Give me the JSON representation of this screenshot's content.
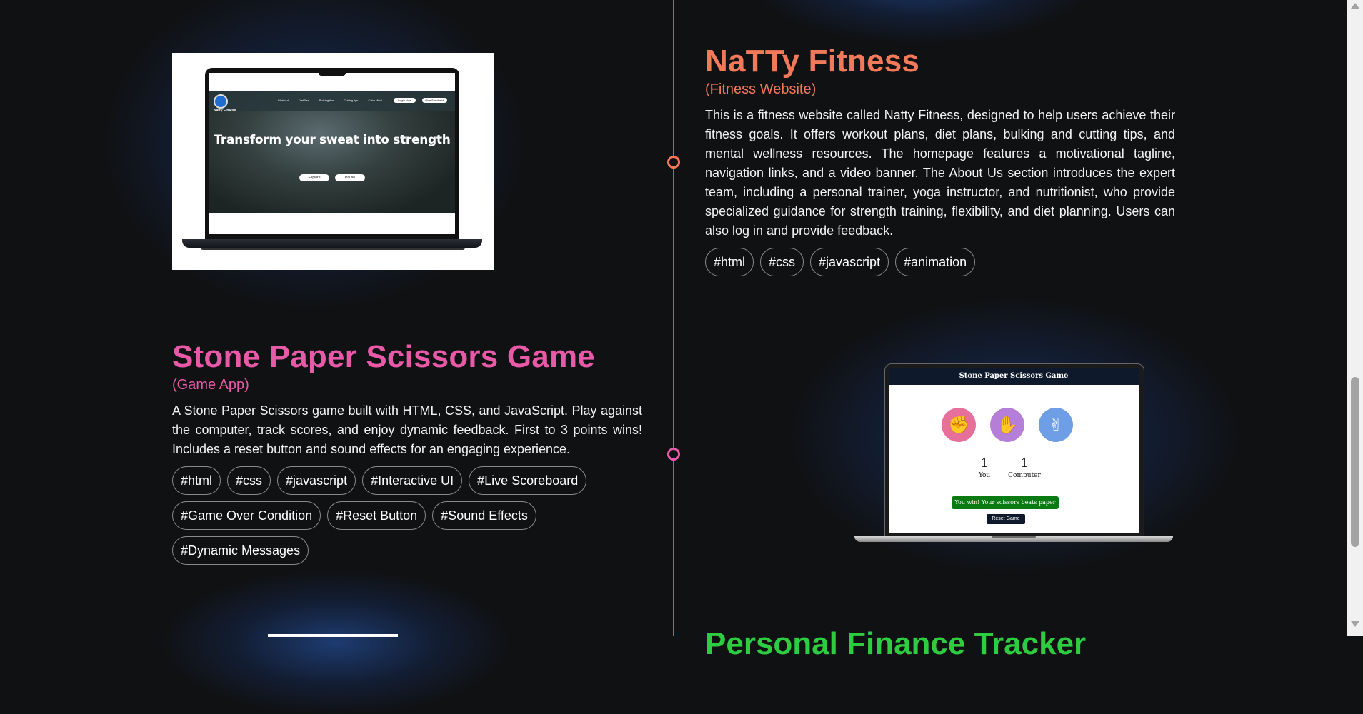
{
  "colors": {
    "background": "#101113",
    "timeline": "#2f8fbd",
    "project1_accent": "#f2795a",
    "project2_accent": "#e85aa8",
    "project3_accent": "#2ecc40"
  },
  "projects": [
    {
      "title": "NaTTy Fitness",
      "subtitle": "(Fitness Website)",
      "description": "This is a fitness website called Natty Fitness, designed to help users achieve their fitness goals. It offers workout plans, diet plans, bulking and cutting tips, and mental wellness resources. The homepage features a motivational tagline, navigation links, and a video banner. The About Us section introduces the expert team, including a personal trainer, yoga instructor, and nutritionist, who provide specialized guidance for strength training, flexibility, and diet planning. Users can also log in and provide feedback.",
      "tags": [
        "#html",
        "#css",
        "#javascript",
        "#animation"
      ],
      "screenshot": {
        "logo_text": "Natty Fitness",
        "nav": [
          "Workout",
          "DietPlan",
          "Bulking tips",
          "Cutting tips",
          "Calm Mind"
        ],
        "login": "Login Now",
        "feedback": "Give Feedback",
        "headline": "Transform your sweat into strength",
        "btn1": "Explore",
        "btn2": "Pause"
      }
    },
    {
      "title": "Stone Paper Scissors Game",
      "subtitle": "(Game App)",
      "description": "A Stone Paper Scissors game built with HTML, CSS, and JavaScript. Play against the computer, track scores, and enjoy dynamic feedback. First to 3 points wins! Includes a reset button and sound effects for an engaging experience.",
      "tags": [
        "#html",
        "#css",
        "#javascript",
        "#Interactive UI",
        "#Live Scoreboard",
        "#Game Over Condition",
        "#Reset Button",
        "#Sound Effects",
        "#Dynamic Messages"
      ],
      "screenshot": {
        "header": "Stone Paper Scissors Game",
        "user_score": "1",
        "user_label": "You",
        "comp_score": "1",
        "comp_label": "Computer",
        "message": "You win! Your scissors beats paper",
        "reset": "Reset Game"
      }
    },
    {
      "title_partial": "Personal Finance Tracker"
    }
  ]
}
